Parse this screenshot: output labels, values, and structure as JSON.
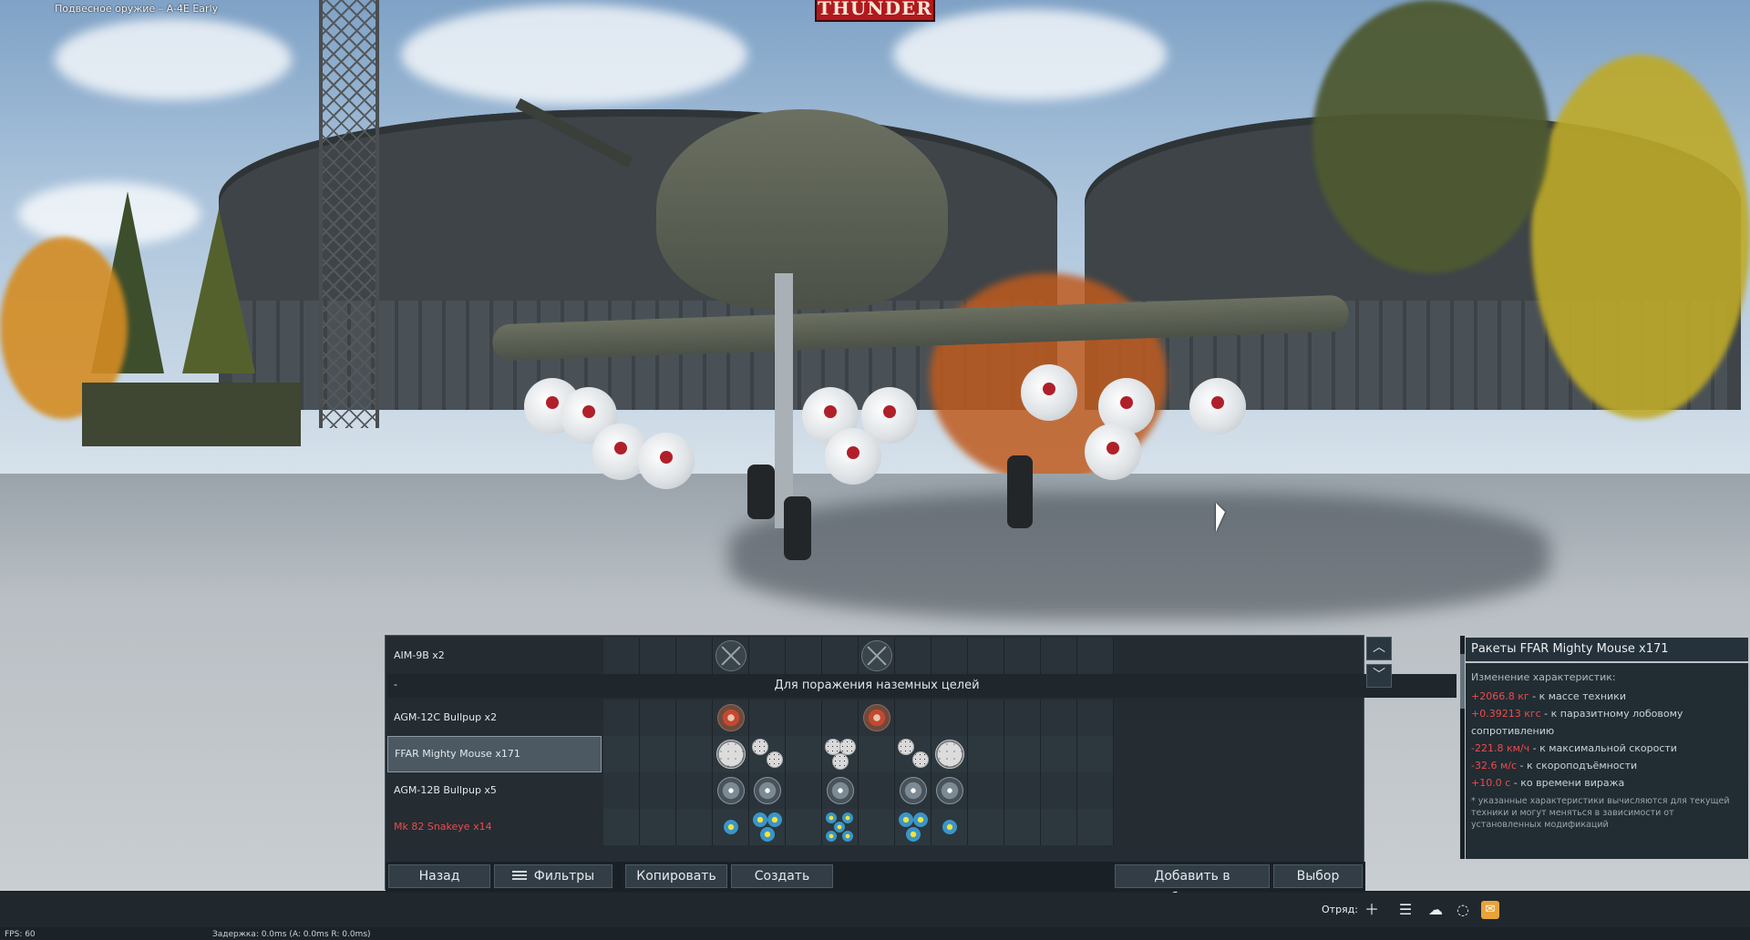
{
  "window_title": "Подвесное оружие – A-4E Early",
  "logo_text": "THUNDER",
  "panel": {
    "section_dash": "-",
    "section_title": "Для поражения наземных целей",
    "rows": [
      {
        "label": "AIM-9B x2",
        "color": "normal"
      },
      {
        "label": "AGM-12C Bullpup x2",
        "color": "normal"
      },
      {
        "label": "FFAR Mighty Mouse x171",
        "color": "normal",
        "selected": true
      },
      {
        "label": "AGM-12B Bullpup x5",
        "color": "normal"
      },
      {
        "label": "Mk 82 Snakeye x14",
        "color": "red"
      }
    ]
  },
  "info": {
    "title": "Ракеты FFAR Mighty Mouse x171",
    "subtitle": "Изменение характеристик:",
    "stats": [
      {
        "value": "+2066.8 кг",
        "text": " - к массе техники"
      },
      {
        "value": "+0.39213 кгс",
        "text": " - к паразитному лобовому сопротивлению"
      },
      {
        "value": "-221.8 км/ч",
        "text": " - к максимальной скорости"
      },
      {
        "value": "-32.6 м/с",
        "text": " - к скороподъёмности"
      },
      {
        "value": "+10.0 с",
        "text": " - ко времени виража"
      }
    ],
    "note": "* указанные характеристики вычисляются для текущей техники и могут меняться в зависимости от установленных модификаций",
    "scroll_up": "︿",
    "scroll_down": "﹀"
  },
  "buttons": {
    "back": "Назад",
    "filters": "Фильтры",
    "copy": "Копировать",
    "create": "Создать",
    "favorites": "Добавить в избранные",
    "select": "Выбор"
  },
  "statusbar": {
    "squad_label": "Отряд:",
    "icons": [
      "plus-icon",
      "list-icon",
      "friends-icon",
      "chat-icon",
      "mail-icon"
    ]
  },
  "fps": "FPS: 60",
  "latency": "Задержка: 0.0ms (A: 0.0ms R: 0.0ms)",
  "colors": {
    "accent_red": "#ef4b4b",
    "logo_red": "#b1191e",
    "panel_bg": "#1b2228",
    "mail": "#e8a33a"
  }
}
